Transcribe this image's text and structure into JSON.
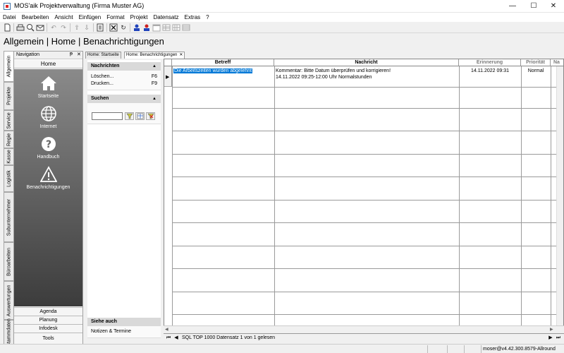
{
  "window": {
    "title": "MOS'aik Projektverwaltung (Firma Muster AG)",
    "minimize_glyph": "—",
    "maximize_glyph": "☐",
    "close_glyph": "✕"
  },
  "menu": [
    "Datei",
    "Bearbeiten",
    "Ansicht",
    "Einfügen",
    "Format",
    "Projekt",
    "Datensatz",
    "Extras",
    "?"
  ],
  "toolbar_icons": [
    "new-document-icon",
    "print-icon",
    "print-preview-icon",
    "email-icon",
    "undo-icon",
    "redo-icon",
    "arrow-up-icon",
    "arrow-down-icon",
    "page-icon",
    "delete-icon",
    "refresh-icon",
    "user-blue-icon",
    "user-red-icon",
    "calendar-icon",
    "table-icon",
    "grid-icon"
  ],
  "page_heading": "Allgemein | Home | Benachrichtigungen",
  "nav": {
    "header_label": "Navigation",
    "pin_glyph": "ᵽ",
    "close_glyph": "✕",
    "home_bar": "Home",
    "side_tabs": [
      "Allgemein",
      "Projekte",
      "Service",
      "Regie",
      "Kasse",
      "Logistik",
      "Subunternehmer",
      "Büroarbeiten",
      "Auswertungen",
      "Stammdaten"
    ],
    "entries": [
      {
        "icon": "home-icon",
        "label": "Startseite"
      },
      {
        "icon": "globe-icon",
        "label": "Internet"
      },
      {
        "icon": "help-icon",
        "label": "Handbuch"
      },
      {
        "icon": "warning-icon",
        "label": "Benachrichtigungen"
      }
    ],
    "bottom_items": [
      "Agenda",
      "Planung",
      "Infodesk",
      "Tools"
    ]
  },
  "tasks": {
    "collapse_glyph": "▲",
    "nachrichten_title": "Nachrichten",
    "loeschen_label": "Löschen...",
    "loeschen_key": "F6",
    "drucken_label": "Drucken...",
    "drucken_key": "F9",
    "suchen_title": "Suchen",
    "search_value": "",
    "siehe_auch_title": "Siehe auch",
    "siehe_auch_item": "Notizen & Termine"
  },
  "doc_tabs": {
    "tab1": "Home: Startseite",
    "tab2": "Home: Benachrichtigungen",
    "tab2_close": "✕"
  },
  "grid": {
    "columns": [
      "Betreff",
      "Nachricht",
      "Erinnerung",
      "Priorität",
      "Na"
    ],
    "current_row_marker": "▶",
    "rows": [
      {
        "betreff": "Die Arbeitszeiten wurden abgelehnt",
        "nachricht_line1": "Kommentar: Bitte Datum überprüfen und korrigieren!",
        "nachricht_line2": "14.11.2022 09:25-12:00 Uhr Normalstunden",
        "erinnerung": "14.11.2022 09:31",
        "prioritaet": "Normal"
      }
    ]
  },
  "record_nav": {
    "first": "⏮",
    "prev": "◀",
    "status": "SQL TOP 1000 Datensatz 1 von 1 gelesen",
    "next": "▶",
    "last": "⏭"
  },
  "status_bar": {
    "user": "moser@v4.42.300.8579-Allround"
  }
}
